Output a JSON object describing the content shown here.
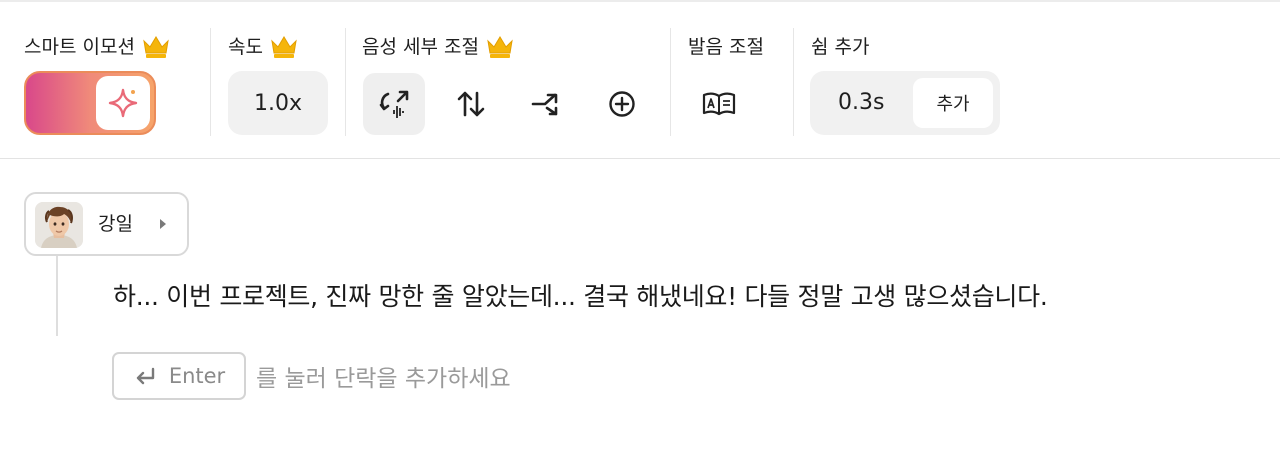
{
  "toolbar": {
    "smart_emotion": {
      "label": "스마트 이모션",
      "premium": true,
      "enabled": true
    },
    "speed": {
      "label": "속도",
      "premium": true,
      "value": "1.0x"
    },
    "voice_detail": {
      "label": "음성 세부 조절",
      "premium": true,
      "tools": [
        "voice-change-icon",
        "pitch-icon",
        "shuffle-icon",
        "add-circle-icon"
      ]
    },
    "pronunciation": {
      "label": "발음 조절",
      "tool": "dictionary-icon"
    },
    "pause": {
      "label": "쉼 추가",
      "value": "0.3s",
      "add_label": "추가"
    }
  },
  "editor": {
    "speaker": {
      "name": "강일"
    },
    "paragraph": "하...  이번 프로젝트, 진짜 망한 줄 알았는데... 결국 해냈네요! 다들 정말 고생 많으셨습니다.",
    "enter_hint": {
      "key_label": "Enter",
      "text": "를 눌러 단락을 추가하세요"
    }
  },
  "colors": {
    "crown": "#f5b50a",
    "toggle_gradient_start": "#d9488a",
    "toggle_gradient_end": "#f6a46a",
    "accent": "#eb6e6e"
  }
}
